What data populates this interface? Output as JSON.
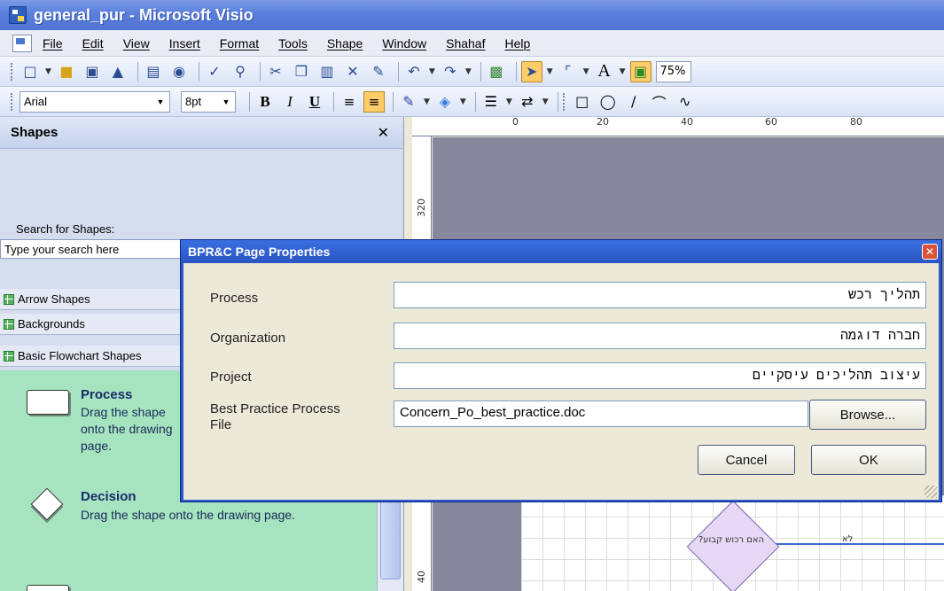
{
  "window": {
    "title": "general_pur - Microsoft Visio"
  },
  "menu": {
    "items": [
      "File",
      "Edit",
      "View",
      "Insert",
      "Format",
      "Tools",
      "Shape",
      "Window",
      "Shahaf",
      "Help"
    ]
  },
  "toolbar": {
    "zoom": "75%"
  },
  "format_toolbar": {
    "font": "Arial",
    "size": "8pt",
    "bold": "B",
    "italic": "I",
    "underline": "U"
  },
  "shapes_pane": {
    "title": "Shapes",
    "search_label": "Search for Shapes:",
    "search_placeholder": "Type your search here",
    "stencils": [
      "Arrow Shapes",
      "Backgrounds",
      "Basic Flowchart Shapes"
    ],
    "masters": [
      {
        "name": "Process",
        "description": "Drag the shape onto the drawing page."
      },
      {
        "name": "Decision",
        "description": "Drag the shape onto the drawing page."
      }
    ]
  },
  "ruler": {
    "top_labels": [
      "0",
      "20",
      "40",
      "60",
      "80"
    ],
    "left_labels": [
      "320",
      "40"
    ]
  },
  "dialog": {
    "title": "BPR&C Page Properties",
    "fields": [
      {
        "label": "Process",
        "value": "תהליך רכש"
      },
      {
        "label": "Organization",
        "value": "חברה דוגמה"
      },
      {
        "label": "Project",
        "value": "עיצוב תהליכים עיסקיים"
      },
      {
        "label": "Best Practice Process File",
        "value": "Concern_Po_best_practice.doc"
      }
    ],
    "browse_label": "Browse...",
    "cancel_label": "Cancel",
    "ok_label": "OK"
  },
  "flowchart": {
    "decision_label": "האם רכוש קבוע?",
    "no_label": "לא"
  },
  "colors": {
    "titlebar": "#5a7fdc",
    "dialog_frame": "#2e58c8",
    "stencil_green": "#a6e4bf",
    "canvas": "#87879d"
  }
}
